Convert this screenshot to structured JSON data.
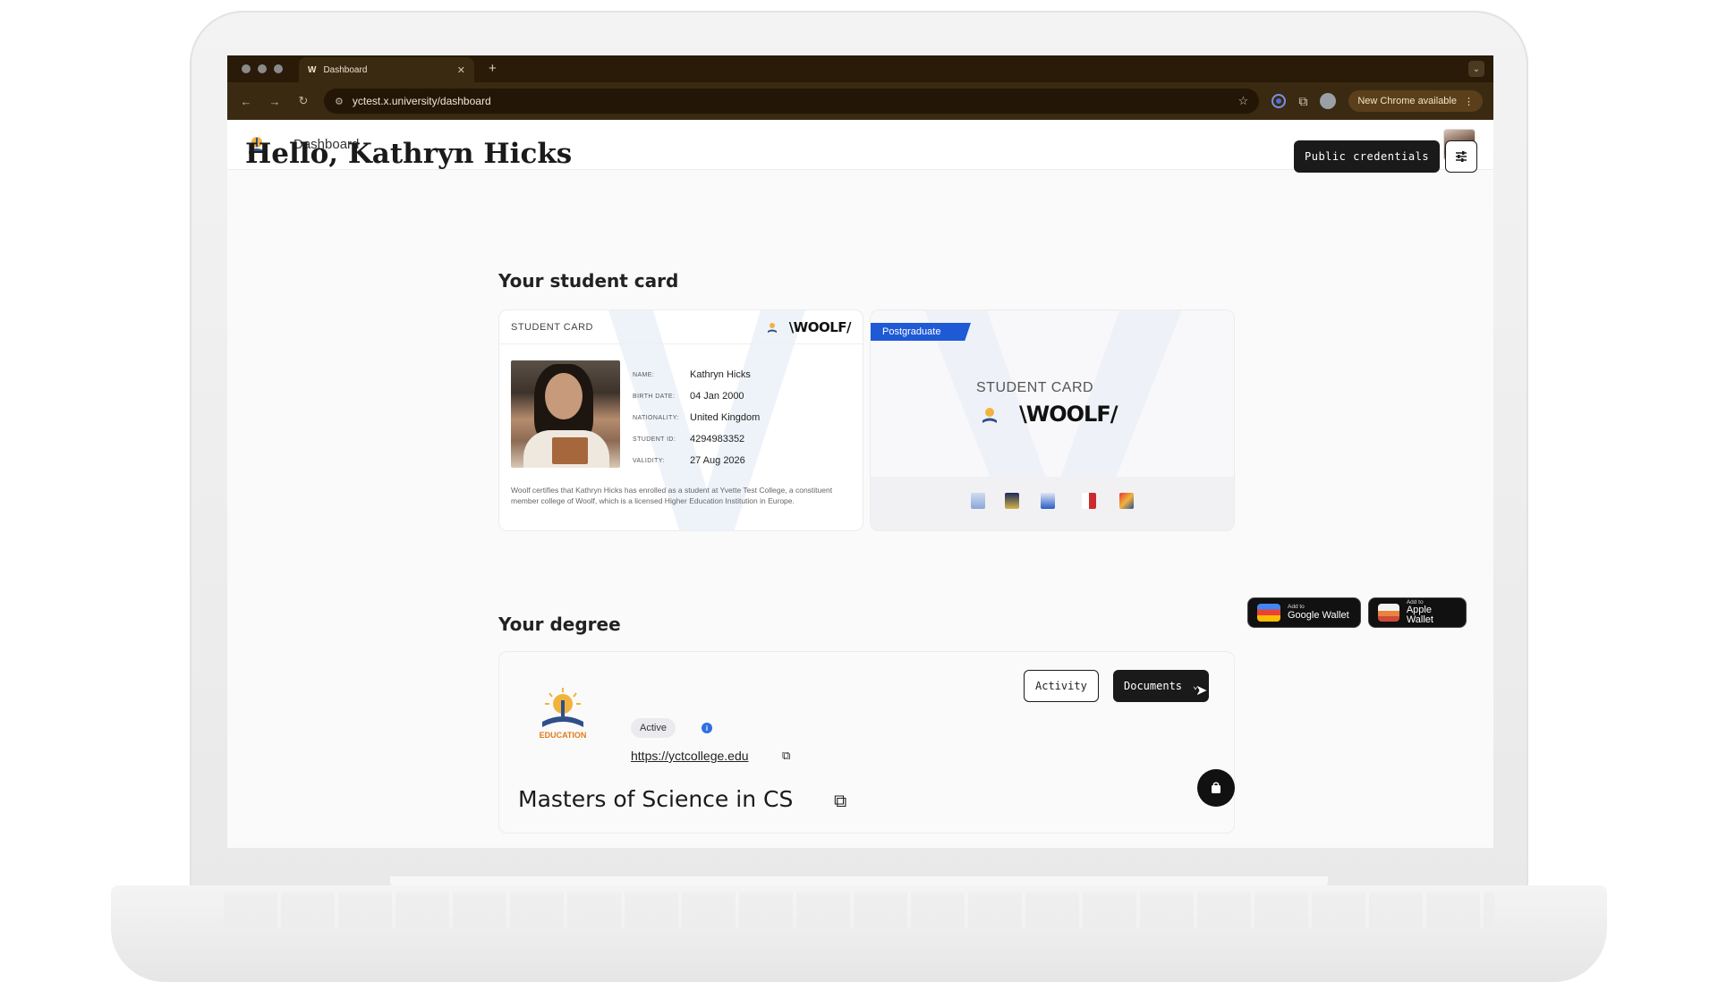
{
  "browser": {
    "tab_title": "Dashboard",
    "tab_icon": "W",
    "url": "yctest.x.university/dashboard",
    "update_label": "New Chrome available"
  },
  "header": {
    "title": "Dashboard"
  },
  "page": {
    "greeting": "Hello, Kathryn Hicks",
    "public_credentials_label": "Public credentials"
  },
  "student_card": {
    "section_title": "Your student card",
    "label": "STUDENT CARD",
    "brand": "\\WOOLF/",
    "fields": [
      {
        "key": "NAME:",
        "value": "Kathryn Hicks"
      },
      {
        "key": "BIRTH DATE:",
        "value": "04 Jan 2000"
      },
      {
        "key": "NATIONALITY:",
        "value": "United Kingdom"
      },
      {
        "key": "STUDENT ID:",
        "value": "4294983352"
      },
      {
        "key": "VALIDITY:",
        "value": "27 Aug 2026"
      }
    ],
    "footnote": "Woolf certifies that Kathryn Hicks has enrolled as a student at Yvette Test College, a constituent member college of Woolf, which is a licensed Higher Education Institution in Europe.",
    "back_badge": "Postgraduate",
    "back_label": "STUDENT CARD",
    "back_brand": "\\WOOLF/"
  },
  "wallet": {
    "google_small": "Add to",
    "google_big": "Google Wallet",
    "apple_small": "Add to",
    "apple_big": "Apple Wallet"
  },
  "degree": {
    "section_title": "Your degree",
    "activity_label": "Activity",
    "documents_label": "Documents",
    "status": "Active",
    "college_url": "https://yctcollege.edu",
    "title": "Masters of Science in CS",
    "logo_text": "EDUCATION"
  },
  "colors": {
    "accent_blue": "#1e5ad6",
    "primary_dark": "#1a1a1a",
    "browser_chrome": "#3a2a12"
  }
}
